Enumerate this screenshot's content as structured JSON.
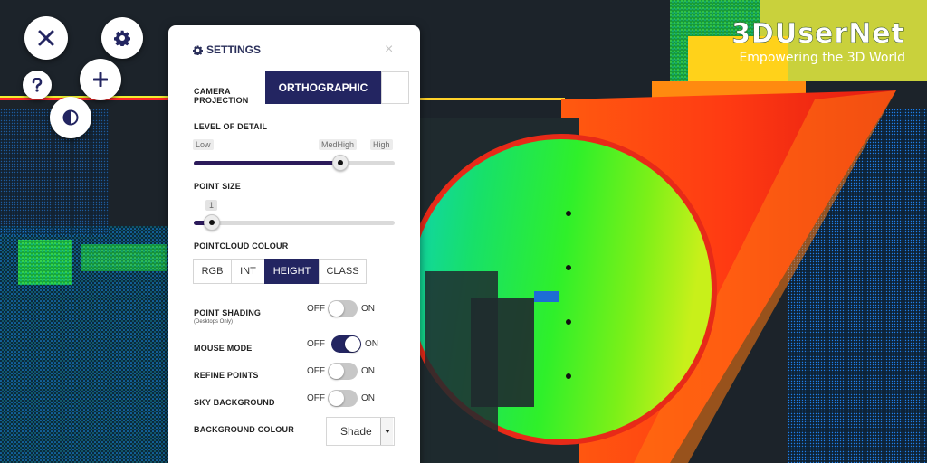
{
  "brand": {
    "name": "3DUserNet",
    "tagline": "Empowering the 3D World"
  },
  "toolbar": {
    "close_icon": "close-icon",
    "settings_icon": "gear-icon",
    "help_icon": "question-icon",
    "add_icon": "plus-icon",
    "contrast_icon": "contrast-icon"
  },
  "settings": {
    "title": "SETTINGS",
    "camera_projection": {
      "label_line1": "CAMERA",
      "label_line2": "PROJECTION",
      "selected": "ORTHOGRAPHIC"
    },
    "level_of_detail": {
      "label": "LEVEL OF DETAIL",
      "ticks": [
        "Low",
        "MedHigh",
        "High"
      ],
      "value_fraction": 0.73
    },
    "point_size": {
      "label": "POINT SIZE",
      "value": "1",
      "value_fraction": 0.09
    },
    "pointcloud_colour": {
      "label": "POINTCLOUD COLOUR",
      "options": [
        "RGB",
        "INT",
        "HEIGHT",
        "CLASS"
      ],
      "selected": "HEIGHT"
    },
    "point_shading": {
      "label": "POINT SHADING",
      "sublabel": "(Desktops Only)",
      "off": "OFF",
      "on": "ON",
      "state": false
    },
    "mouse_mode": {
      "label": "MOUSE MODE",
      "off": "OFF",
      "on": "ON",
      "state": true
    },
    "refine_points": {
      "label": "REFINE POINTS",
      "off": "OFF",
      "on": "ON",
      "state": false
    },
    "sky_background": {
      "label": "SKY BACKGROUND",
      "off": "OFF",
      "on": "ON",
      "state": false
    },
    "background_colour": {
      "label": "BACKGROUND COLOUR",
      "value": "Shade"
    }
  },
  "colors": {
    "accent": "#232561",
    "panel": "#ffffff",
    "background": "#1c232a"
  }
}
